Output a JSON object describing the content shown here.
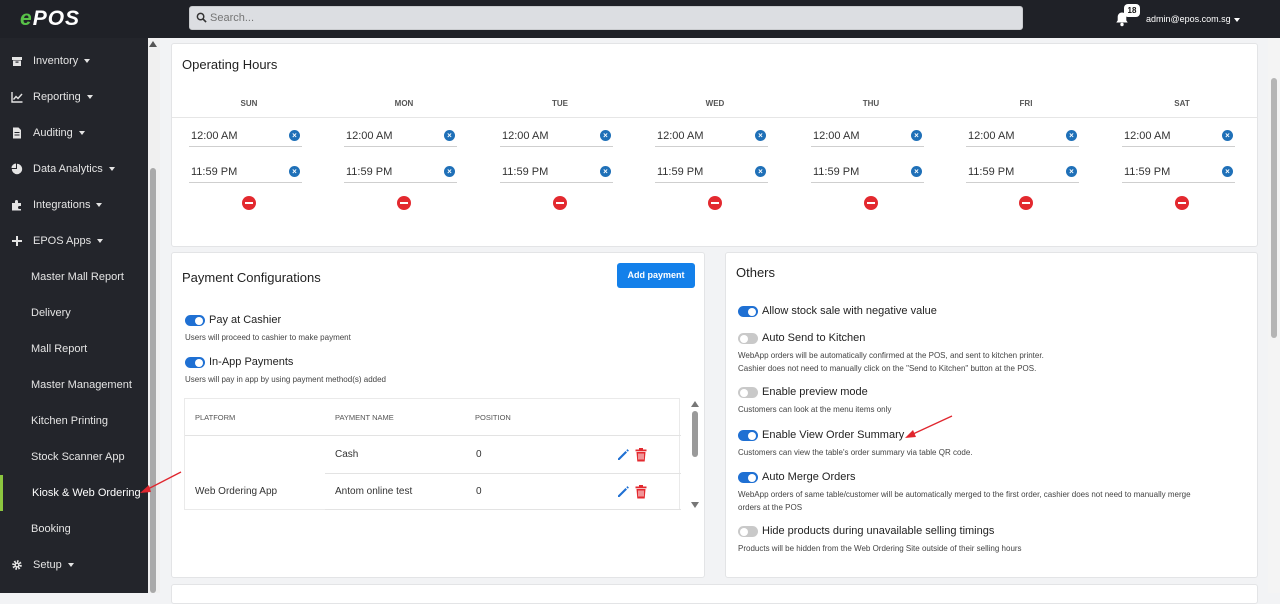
{
  "header": {
    "logo_e": "e",
    "logo_text": "POS",
    "search_placeholder": "Search...",
    "notification_count": "18",
    "user_email": "admin@epos.com.sg"
  },
  "sidebar": {
    "items": [
      {
        "label": "Inventory",
        "icon": "inventory-icon"
      },
      {
        "label": "Reporting",
        "icon": "chart-line-icon"
      },
      {
        "label": "Auditing",
        "icon": "document-icon"
      },
      {
        "label": "Data Analytics",
        "icon": "pie-chart-icon"
      },
      {
        "label": "Integrations",
        "icon": "puzzle-icon"
      },
      {
        "label": "EPOS Apps",
        "icon": "plus-icon"
      }
    ],
    "subitems": [
      {
        "label": "Master Mall Report"
      },
      {
        "label": "Delivery"
      },
      {
        "label": "Mall Report"
      },
      {
        "label": "Master Management"
      },
      {
        "label": "Kitchen Printing"
      },
      {
        "label": "Stock Scanner App"
      },
      {
        "label": "Kiosk & Web Ordering"
      },
      {
        "label": "Booking"
      }
    ],
    "setup": {
      "label": "Setup",
      "icon": "gear-icon"
    }
  },
  "operating_hours": {
    "title": "Operating Hours",
    "days": [
      {
        "name": "SUN",
        "open": "12:00 AM",
        "close": "11:59 PM"
      },
      {
        "name": "MON",
        "open": "12:00 AM",
        "close": "11:59 PM"
      },
      {
        "name": "TUE",
        "open": "12:00 AM",
        "close": "11:59 PM"
      },
      {
        "name": "WED",
        "open": "12:00 AM",
        "close": "11:59 PM"
      },
      {
        "name": "THU",
        "open": "12:00 AM",
        "close": "11:59 PM"
      },
      {
        "name": "FRI",
        "open": "12:00 AM",
        "close": "11:59 PM"
      },
      {
        "name": "SAT",
        "open": "12:00 AM",
        "close": "11:59 PM"
      }
    ]
  },
  "payment": {
    "title": "Payment Configurations",
    "add_button": "Add payment",
    "pay_at_cashier": {
      "label": "Pay at Cashier",
      "desc": "Users will proceed to cashier to make payment",
      "on": true
    },
    "in_app": {
      "label": "In-App Payments",
      "desc": "Users will pay in app by using payment method(s) added",
      "on": true
    },
    "table": {
      "headers": {
        "platform": "PLATFORM",
        "name": "PAYMENT NAME",
        "position": "POSITION"
      },
      "platform": "Web Ordering App",
      "rows": [
        {
          "name": "Cash",
          "position": "0"
        },
        {
          "name": "Antom online test",
          "position": "0"
        }
      ]
    }
  },
  "others": {
    "title": "Others",
    "options": [
      {
        "label": "Allow stock sale with negative value",
        "desc1": "",
        "desc2": "",
        "on": true
      },
      {
        "label": "Auto Send to Kitchen",
        "desc1": "WebApp orders will be automatically confirmed at the POS, and sent to kitchen printer.",
        "desc2": "Cashier does not need to manually click on the \"Send to Kitchen\" button at the POS.",
        "on": false
      },
      {
        "label": "Enable preview mode",
        "desc1": "Customers can look at the menu items only",
        "desc2": "",
        "on": false
      },
      {
        "label": "Enable View Order Summary",
        "desc1": "Customers can view the table's order summary via table QR code.",
        "desc2": "",
        "on": true
      },
      {
        "label": "Auto Merge Orders",
        "desc1": "WebApp orders of same table/customer will be automatically merged to the first order, cashier does not need to manually merge",
        "desc2": "orders at the POS",
        "on": true
      },
      {
        "label": "Hide products during unavailable selling timings",
        "desc1": "Products will be hidden from the Web Ordering Site outside of their selling hours",
        "desc2": "",
        "on": false
      }
    ]
  },
  "colors": {
    "accent": "#1380ea",
    "danger": "#e3292f",
    "sidebar_bg": "#23252b",
    "active_bar": "#8cc63f",
    "annotation": "#e0262e"
  }
}
